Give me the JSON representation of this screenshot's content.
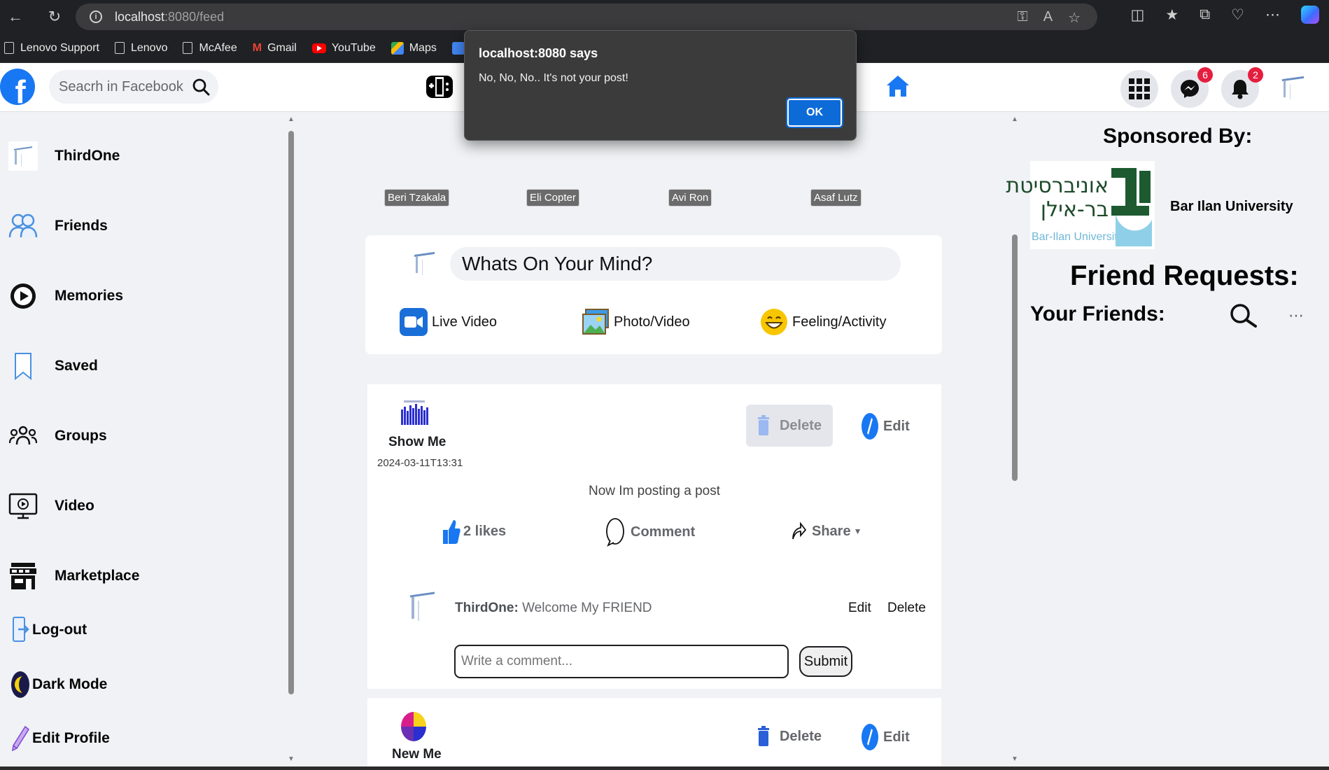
{
  "browser": {
    "url_host": "localhost",
    "url_path": ":8080/feed",
    "bookmarks": [
      "Lenovo Support",
      "Lenovo",
      "McAfee",
      "Gmail",
      "YouTube",
      "Maps"
    ]
  },
  "header": {
    "logo": "f",
    "search_placeholder": "Seacrh in Facebook",
    "messenger_badge": "6",
    "notifications_badge": "2"
  },
  "sidebar": {
    "items": [
      {
        "label": "ThirdOne",
        "icon": "profile-avatar-icon"
      },
      {
        "label": "Friends",
        "icon": "friends-icon"
      },
      {
        "label": "Memories",
        "icon": "memories-icon"
      },
      {
        "label": "Saved",
        "icon": "bookmark-icon"
      },
      {
        "label": "Groups",
        "icon": "groups-icon"
      },
      {
        "label": "Video",
        "icon": "video-icon"
      },
      {
        "label": "Marketplace",
        "icon": "store-icon"
      },
      {
        "label": "Log-out",
        "icon": "logout-icon"
      },
      {
        "label": "Dark Mode",
        "icon": "moon-icon"
      },
      {
        "label": "Edit Profile",
        "icon": "pencil-icon"
      }
    ]
  },
  "stories": [
    "Beri Tzakala",
    "Eli Copter",
    "Avi Ron",
    "Asaf Lutz"
  ],
  "create_post": {
    "placeholder": "Whats On Your Mind?",
    "actions": [
      "Live Video",
      "Photo/Video",
      "Feeling/Activity"
    ]
  },
  "posts": [
    {
      "author": "Show Me",
      "date": "2024-03-11T13:31",
      "text": "Now Im posting a post",
      "delete_label": "Delete",
      "edit_label": "Edit",
      "likes_label": "2 likes",
      "comment_label": "Comment",
      "share_label": "Share",
      "comments": [
        {
          "author": "ThirdOne:",
          "text": "Welcome My FRIEND",
          "edit": "Edit",
          "delete": "Delete"
        }
      ],
      "comment_placeholder": "Write a comment...",
      "submit_label": "Submit"
    },
    {
      "author": "New Me",
      "delete_label": "Delete",
      "edit_label": "Edit"
    }
  ],
  "right": {
    "sponsored_title": "Sponsored By:",
    "sponsor_name": "Bar Ilan University",
    "sponsor_logo_hebrew_1": "אוניברסיטת",
    "sponsor_logo_hebrew_2": "בר-אילן",
    "sponsor_logo_english": "Bar-Ilan University",
    "friend_requests_title": "Friend Requests:",
    "your_friends_title": "Your Friends:"
  },
  "dialog": {
    "title": "localhost:8080 says",
    "message": "No, No, No.. It's not your post!",
    "ok_label": "OK"
  },
  "colors": {
    "brand": "#1877f2",
    "badge": "#e41e3f",
    "dialog_bg": "#3b3b3b",
    "dialog_button": "#0d6bd8"
  }
}
